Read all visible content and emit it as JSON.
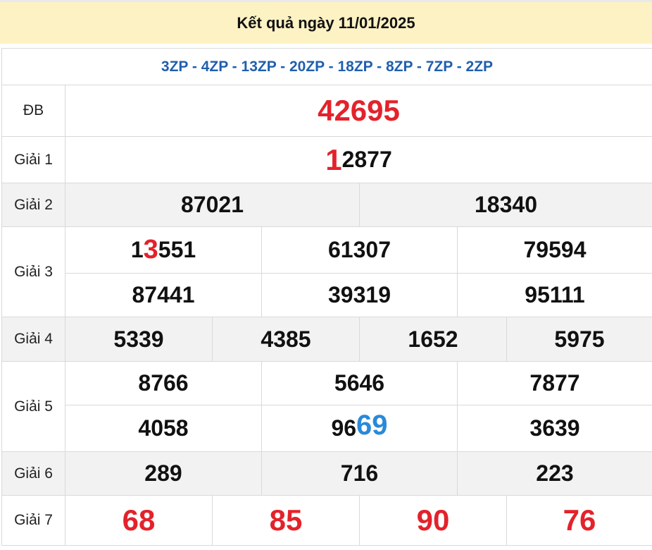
{
  "header": {
    "title": "Kết quả ngày 11/01/2025"
  },
  "codes": "3ZP - 4ZP - 13ZP - 20ZP - 18ZP - 8ZP - 7ZP - 2ZP",
  "prizes": {
    "db": {
      "label": "ĐB",
      "value": "42695"
    },
    "g1": {
      "label": "Giải 1",
      "highlight": "1",
      "rest": "2877"
    },
    "g2": {
      "label": "Giải 2",
      "values": [
        "87021",
        "18340"
      ]
    },
    "g3": {
      "label": "Giải 3",
      "v1_prefix": "1",
      "v1_highlight": "3",
      "v1_rest": "551",
      "values": [
        "61307",
        "79594",
        "87441",
        "39319",
        "95111"
      ]
    },
    "g4": {
      "label": "Giải 4",
      "values": [
        "5339",
        "4385",
        "1652",
        "5975"
      ]
    },
    "g5": {
      "label": "Giải 5",
      "values": [
        "8766",
        "5646",
        "7877",
        "4058",
        "3639"
      ],
      "v5_prefix": "96",
      "v5_highlight": "69"
    },
    "g6": {
      "label": "Giải 6",
      "values": [
        "289",
        "716",
        "223"
      ]
    },
    "g7": {
      "label": "Giải 7",
      "values": [
        "68",
        "85",
        "90",
        "76"
      ]
    }
  },
  "colors": {
    "header_bg": "#fcf2c4",
    "highlight_red": "#e3222b",
    "highlight_blue": "#2a89d8",
    "code_blue": "#1f5fae",
    "shade": "#f2f2f2"
  }
}
